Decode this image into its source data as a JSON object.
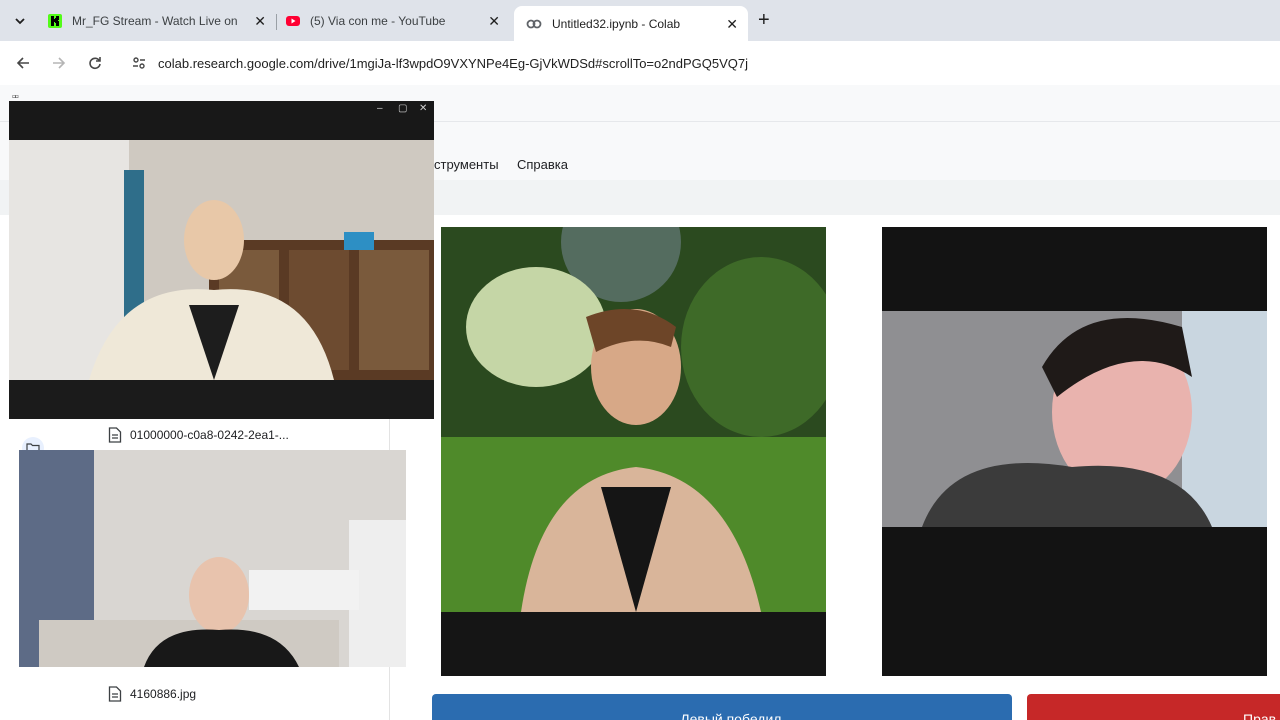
{
  "browser": {
    "tabs": [
      {
        "title": "Mr_FG Stream - Watch Live on K",
        "favicon": "kick-icon",
        "active": false
      },
      {
        "title": "(5) Via con me - YouTube",
        "favicon": "youtube-icon",
        "active": false
      },
      {
        "title": "Untitled32.ipynb - Colab",
        "favicon": "colab-icon",
        "active": true
      }
    ],
    "url": "colab.research.google.com/drive/1mgiJa-lf3wpdO9VXYNPe4Eg-GjVkWDSd#scrollTo=o2ndPGQ5VQ7j"
  },
  "colab": {
    "menu": [
      "струменты",
      "Справка"
    ],
    "files": [
      {
        "name": "01000000-c0a8-0242-2ea1-..."
      },
      {
        "name": "4160886.jpg"
      }
    ]
  },
  "videos": [
    {
      "name": "pip-window-top-left"
    },
    {
      "name": "video-bottom-left"
    },
    {
      "name": "video-center"
    },
    {
      "name": "video-right"
    }
  ],
  "buttons": {
    "left_winner": "← Левый победил",
    "right_winner": "Прав"
  },
  "colors": {
    "tabstrip": "#dfe3ea",
    "blue_button": "#2b6cb0",
    "red_button": "#c62828"
  }
}
